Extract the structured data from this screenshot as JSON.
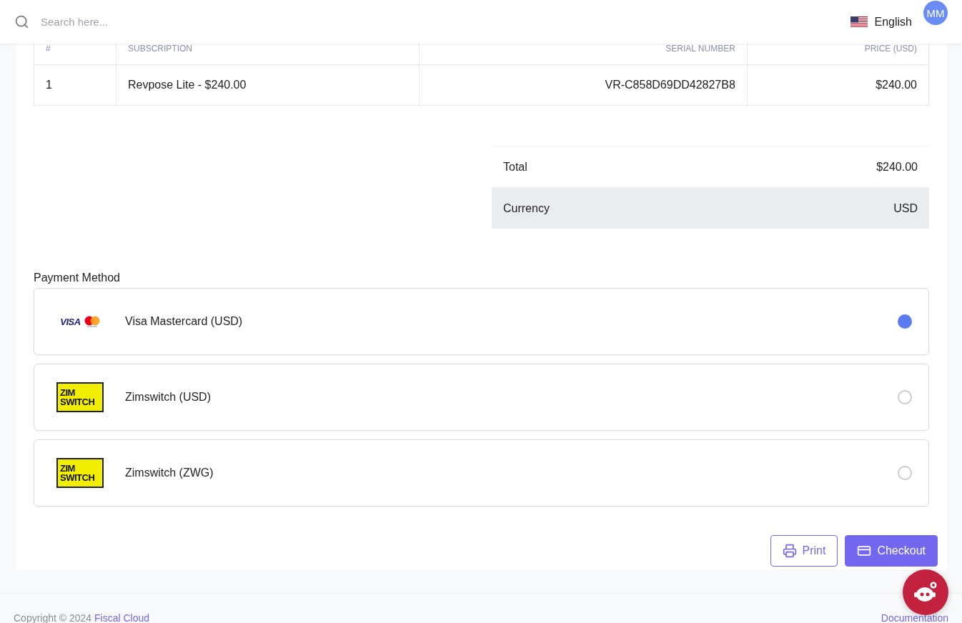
{
  "topbar": {
    "search": {
      "placeholder": "Search here..."
    },
    "language": "English",
    "avatar": "MM"
  },
  "table": {
    "columns": [
      "#",
      "SUBSCRIPTION",
      "SERIAL NUMBER",
      "PRICE (USD)"
    ],
    "rows": [
      [
        "1",
        "Revpose Lite - $240.00",
        "VR-C858D69DD42827B8",
        "$240.00"
      ]
    ]
  },
  "summary": [
    {
      "label": "Total",
      "value": "$240.00",
      "shaded": false
    },
    {
      "label": "Currency",
      "value": "USD",
      "shaded": true
    }
  ],
  "payment": {
    "label": "Payment Method",
    "options": [
      {
        "kind": "card",
        "logo_text": "VISA",
        "label": "Visa Mastercard (USD)",
        "selected": true
      },
      {
        "kind": "zimswitch",
        "logo_text": [
          "ZIM",
          "SWITCH"
        ],
        "label": "Zimswitch (USD)",
        "selected": false
      },
      {
        "kind": "zimswitch",
        "logo_text": [
          "ZIM",
          "SWITCH"
        ],
        "label": "Zimswitch (ZWG)",
        "selected": false
      }
    ]
  },
  "actions": [
    {
      "kind": "outline",
      "label": "Print"
    },
    {
      "kind": "primary",
      "label": "Checkout"
    }
  ],
  "footer": {
    "copyright": "Copyright © 2024",
    "brand": "Fiscal Cloud",
    "link": "Documentation"
  }
}
